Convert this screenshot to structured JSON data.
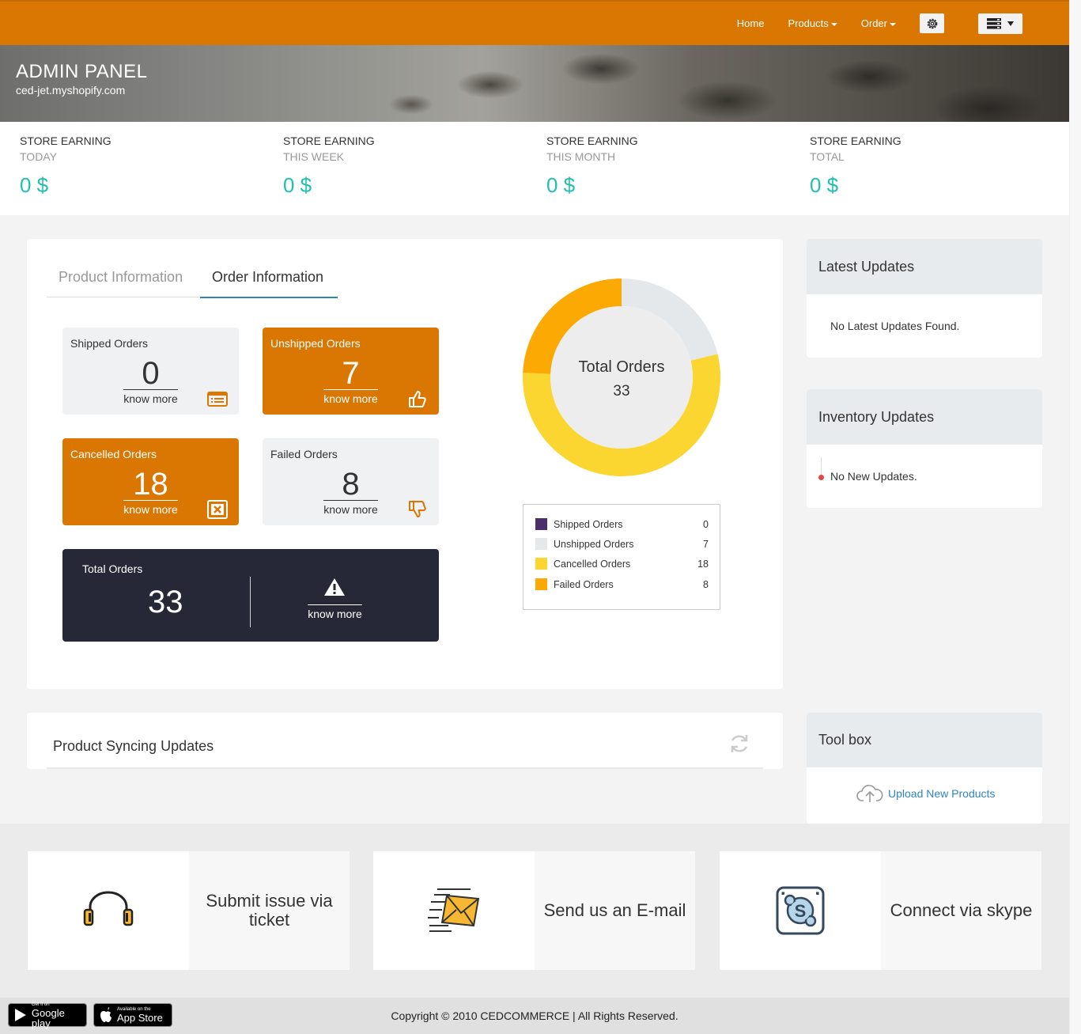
{
  "navbar": {
    "links": [
      {
        "label": "Home"
      },
      {
        "label": "Products"
      },
      {
        "label": "Order"
      }
    ],
    "gear_icon": "gear-icon",
    "menu_icon": "server-menu-icon"
  },
  "banner": {
    "title": "ADMIN PANEL",
    "store": "ced-jet.myshopify.com"
  },
  "earnings": [
    {
      "label": "STORE EARNING",
      "period": "TODAY",
      "value": "0 $"
    },
    {
      "label": "STORE EARNING",
      "period": "THIS WEEK",
      "value": "0 $"
    },
    {
      "label": "STORE EARNING",
      "period": "THIS MONTH",
      "value": "0 $"
    },
    {
      "label": "STORE EARNING",
      "period": "TOTAL",
      "value": "0 $"
    }
  ],
  "tabs": {
    "product": "Product Information",
    "order": "Order Information"
  },
  "stats": {
    "shipped": {
      "title": "Shipped Orders",
      "value": "0",
      "more": "know more"
    },
    "unshipped": {
      "title": "Unshipped Orders",
      "value": "7",
      "more": "know more"
    },
    "cancelled": {
      "title": "Cancelled Orders",
      "value": "18",
      "more": "know more"
    },
    "failed": {
      "title": "Failed Orders",
      "value": "8",
      "more": "know more"
    }
  },
  "total": {
    "title": "Total Orders",
    "value": "33",
    "more": "know more"
  },
  "chart_data": {
    "type": "pie",
    "title": "Total Orders",
    "total": "33",
    "categories": [
      "Shipped Orders",
      "Unshipped Orders",
      "Cancelled Orders",
      "Failed Orders"
    ],
    "values": [
      0,
      7,
      18,
      8
    ],
    "colors": [
      "#4b2e6b",
      "#e5e8ea",
      "#fbd630",
      "#fca903"
    ],
    "legend": "below"
  },
  "latest_updates": {
    "title": "Latest Updates",
    "message": "No Latest Updates Found."
  },
  "inventory_updates": {
    "title": "Inventory Updates",
    "message": "No New Updates."
  },
  "sync": {
    "title": "Product Syncing Updates"
  },
  "toolbox": {
    "title": "Tool box",
    "upload": "Upload New Products"
  },
  "support": [
    {
      "label": "Submit issue via ticket",
      "icon": "headphones-icon"
    },
    {
      "label": "Send us an E-mail",
      "icon": "email-icon"
    },
    {
      "label": "Connect via skype",
      "icon": "skype-icon"
    }
  ],
  "footer": {
    "google_small": "Get it on",
    "google_big": "Google play",
    "apple_small": "Available on the",
    "apple_big": "App Store",
    "copyright": "Copyright © 2010 CEDCOMMERCE | All Rights Reserved."
  },
  "colors": {
    "brand": "#da7602",
    "accent_teal": "#1fc0b0",
    "dark": "#272837",
    "link": "#2e86c1"
  }
}
